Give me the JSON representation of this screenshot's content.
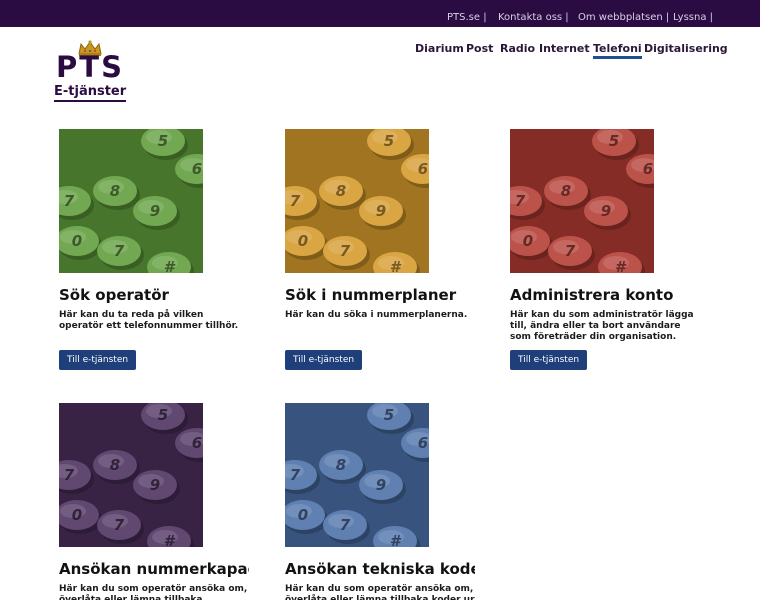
{
  "header": {
    "top_links": [
      "PTS.se |",
      "Kontakta oss |",
      "Om webbplatsen |",
      "Lyssna |"
    ],
    "logo_text": "PTS",
    "logo_subtitle": "E-tjänster",
    "nav_items": [
      "Diarium",
      "Post",
      "Radio",
      "Internet",
      "Telefoni",
      "Digitalisering"
    ],
    "active_nav": "Telefoni"
  },
  "colors": {
    "top_bar": "#2a0c42",
    "button": "#1e3f7a",
    "card_green": "#5f9c3a",
    "card_orange": "#d59a2a",
    "card_red": "#b33b32",
    "card_purple": "#4a2f5c",
    "card_blue": "#4a6fa8"
  },
  "keypad_digits": [
    "5",
    "6",
    "8",
    "9",
    "0",
    "7",
    "#"
  ],
  "cards": [
    {
      "title": "Sök operatör",
      "description": "Här kan du ta reda på vilken operatör ett telefonnummer tillhör.",
      "button_label": "Till e-tjänsten",
      "color": "green"
    },
    {
      "title": "Sök i nummerplaner",
      "description": "Här kan du söka i nummerplanerna.",
      "button_label": "Till e-tjänsten",
      "color": "orange"
    },
    {
      "title": "Administrera konto",
      "description": "Här kan du som administratör lägga till, ändra eller ta bort användare som företräder din organisation.",
      "button_label": "Till e-tjänsten",
      "color": "red"
    },
    {
      "title": "Ansökan nummerkapacitet",
      "description": "Här kan du som operatör ansöka om, överlåta eller lämna tillbaka nummerkapacitet.",
      "color": "purple"
    },
    {
      "title": "Ansökan tekniska koder",
      "description": "Här kan du som operatör ansöka om, överlåta eller lämna tillbaka koder ur tekniska planer.",
      "color": "blue"
    }
  ]
}
